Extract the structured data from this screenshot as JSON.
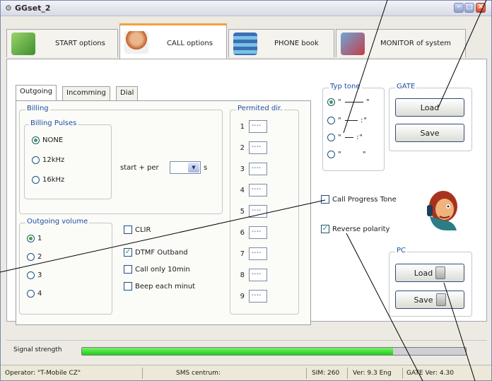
{
  "window": {
    "title": "GGset_2"
  },
  "main_tabs": [
    {
      "label": "START options"
    },
    {
      "label": "CALL options"
    },
    {
      "label": "PHONE book"
    },
    {
      "label": "MONITOR of system"
    }
  ],
  "inner_tabs": [
    {
      "label": "Outgoing"
    },
    {
      "label": "Incomming"
    },
    {
      "label": "Dial"
    }
  ],
  "billing": {
    "legend": "Billing",
    "pulses_legend": "Billing Pulses",
    "options": [
      "NONE",
      "12kHz",
      "16kHz"
    ],
    "selected": "NONE",
    "start_per_label": "start + per",
    "unit": "s"
  },
  "outgoing_volume": {
    "legend": "Outgoing volume",
    "options": [
      "1",
      "2",
      "3",
      "4"
    ],
    "selected": "1"
  },
  "checks": {
    "clir": {
      "label": "CLIR",
      "checked": false
    },
    "dtmf": {
      "label": "DTMF Outband",
      "checked": true
    },
    "call_only": {
      "label": "Call only 10min",
      "checked": false
    },
    "beep": {
      "label": "Beep each minut",
      "checked": false
    }
  },
  "permitted": {
    "legend": "Permited dir.",
    "rows": [
      "1",
      "2",
      "3",
      "4",
      "5",
      "6",
      "7",
      "8",
      "9"
    ],
    "mask": "****"
  },
  "typ_tone": {
    "legend": "Typ tone",
    "selected_index": 0
  },
  "gate": {
    "legend": "GATE",
    "load": "Load",
    "save": "Save"
  },
  "call_progress_tone": {
    "label": "Call Progress Tone",
    "checked": false
  },
  "reverse_polarity": {
    "label": "Reverse polarity",
    "checked": true
  },
  "pc": {
    "legend": "PC",
    "load": "Load",
    "save": "Save"
  },
  "signal": {
    "label": "Signal strength",
    "level": 0.81
  },
  "status": {
    "operator": "Operator: \"T-Mobile CZ\"",
    "sms": "SMS centrum:",
    "sim": "SIM: 260",
    "version": "Ver: 9.3 Eng",
    "gate_ver": "GATE Ver: 4.30"
  },
  "colors": {
    "active_tab_accent": "#f4a13a",
    "legend_blue": "#1f4fa0",
    "signal_green": "#1ccf18"
  }
}
